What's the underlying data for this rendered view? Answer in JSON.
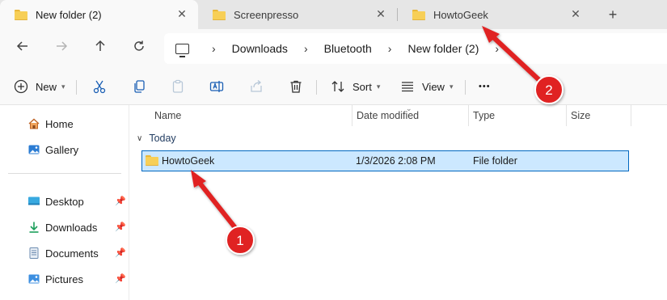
{
  "tabs": [
    {
      "title": "New folder (2)",
      "active": true
    },
    {
      "title": "Screenpresso",
      "active": false
    },
    {
      "title": "HowtoGeek",
      "active": false
    }
  ],
  "tab_close_glyph": "✕",
  "new_tab_glyph": "+",
  "breadcrumb": [
    "Downloads",
    "Bluetooth",
    "New folder (2)"
  ],
  "commands": {
    "new_label": "New",
    "sort_label": "Sort",
    "view_label": "View",
    "more_glyph": "•••"
  },
  "sidebar": {
    "top": [
      {
        "label": "Home",
        "icon": "home-icon"
      },
      {
        "label": "Gallery",
        "icon": "gallery-icon"
      }
    ],
    "pinned": [
      {
        "label": "Desktop",
        "icon": "desktop-icon"
      },
      {
        "label": "Downloads",
        "icon": "downloads-icon"
      },
      {
        "label": "Documents",
        "icon": "documents-icon"
      },
      {
        "label": "Pictures",
        "icon": "pictures-icon"
      }
    ]
  },
  "columns": [
    "Name",
    "Date modified",
    "Type",
    "Size"
  ],
  "group_label": "Today",
  "rows": [
    {
      "name": "HowtoGeek",
      "date": "1/3/2026 2:08 PM",
      "type": "File folder",
      "size": ""
    }
  ],
  "annotations": [
    {
      "number": "1",
      "color": "#e02020"
    },
    {
      "number": "2",
      "color": "#e02020"
    }
  ],
  "colors": {
    "selection_fill": "#cce8ff",
    "selection_border": "#0067c0",
    "folder_yellow": "#f7cf57",
    "accent_blue": "#0067c0"
  }
}
